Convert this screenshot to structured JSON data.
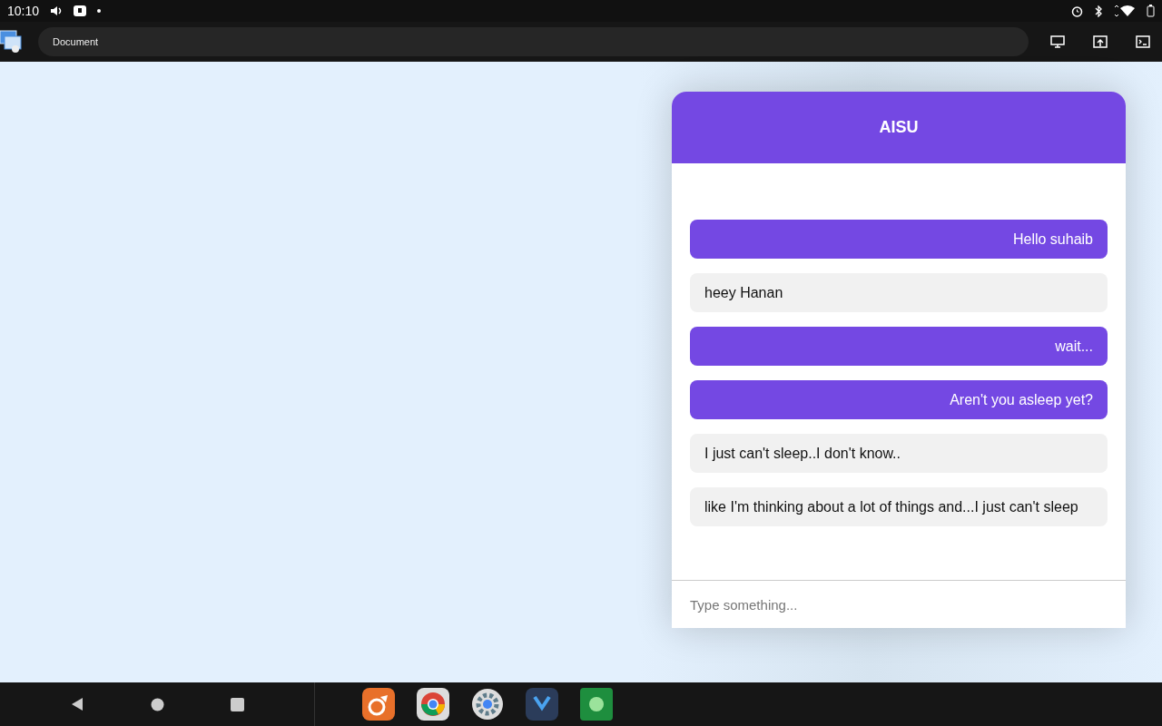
{
  "status_bar": {
    "time": "10:10"
  },
  "browser": {
    "tab_title": "Document"
  },
  "chat": {
    "title": "AISU",
    "messages": [
      {
        "kind": "sent",
        "text": "Hello suhaib"
      },
      {
        "kind": "received",
        "text": "heey Hanan"
      },
      {
        "kind": "sent",
        "text": "wait..."
      },
      {
        "kind": "sent",
        "text": "Aren't you asleep yet?"
      },
      {
        "kind": "received",
        "text": "I just can't sleep..I don't know.."
      },
      {
        "kind": "received",
        "text": "like I'm thinking about a lot of things and...I just can't sleep"
      }
    ],
    "input": {
      "placeholder": "Type something..."
    }
  }
}
